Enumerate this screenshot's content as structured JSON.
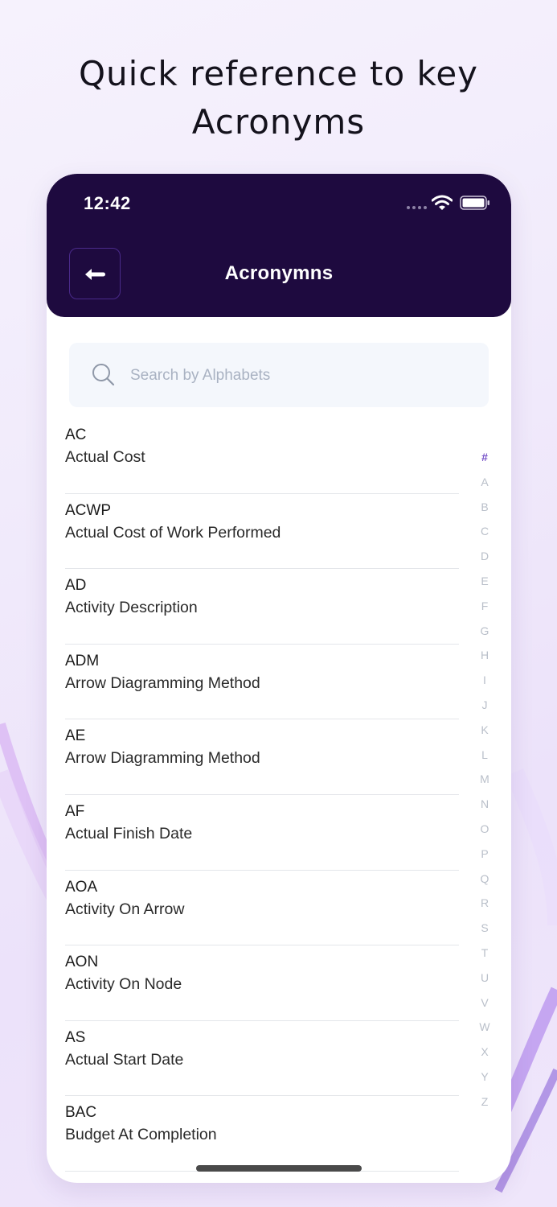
{
  "headline": [
    "Quick reference to key",
    "Acronyms"
  ],
  "status_bar": {
    "time": "12:42"
  },
  "header": {
    "title": "Acronymns",
    "back_icon": "arrow-left-icon"
  },
  "search": {
    "placeholder": "Search by Alphabets",
    "value": "",
    "icon": "search-icon"
  },
  "acronyms": [
    {
      "code": "AC",
      "meaning": "Actual Cost"
    },
    {
      "code": "ACWP",
      "meaning": "Actual Cost of Work Performed"
    },
    {
      "code": "AD",
      "meaning": "Activity Description"
    },
    {
      "code": "ADM",
      "meaning": "Arrow Diagramming Method"
    },
    {
      "code": "AE",
      "meaning": "Arrow Diagramming Method"
    },
    {
      "code": "AF",
      "meaning": "Actual Finish Date"
    },
    {
      "code": "AOA",
      "meaning": "Activity On Arrow"
    },
    {
      "code": "AON",
      "meaning": "Activity On Node"
    },
    {
      "code": "AS",
      "meaning": "Actual Start Date"
    },
    {
      "code": "BAC",
      "meaning": "Budget At Completion"
    }
  ],
  "alphabet_index": [
    "#",
    "A",
    "B",
    "C",
    "D",
    "E",
    "F",
    "G",
    "H",
    "I",
    "J",
    "K",
    "L",
    "M",
    "N",
    "O",
    "P",
    "Q",
    "R",
    "S",
    "T",
    "U",
    "V",
    "W",
    "X",
    "Y",
    "Z"
  ],
  "alphabet_active": "#",
  "colors": {
    "header_bg": "#1e0a3f",
    "accent": "#7651c8",
    "index_inactive": "#b9bfc9",
    "search_bg": "#f4f7fc"
  }
}
